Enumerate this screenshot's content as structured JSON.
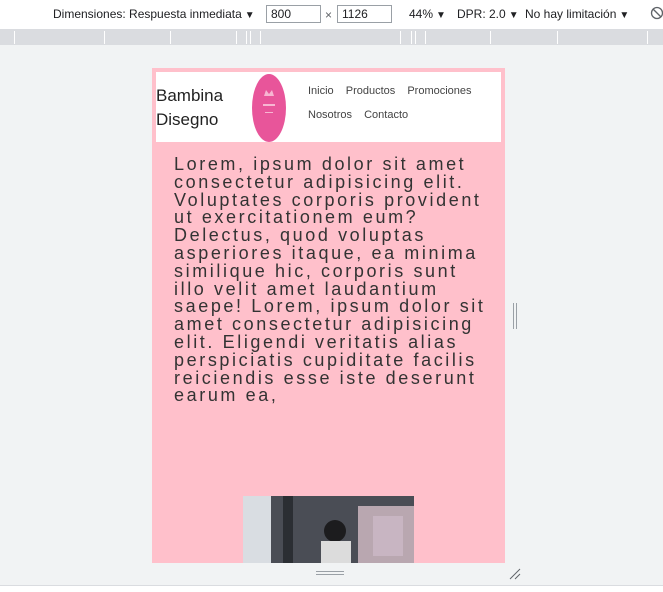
{
  "devtools": {
    "dimensions_label": "Dimensiones: Respuesta inmediata",
    "width": "800",
    "times": "×",
    "height": "1126",
    "zoom": "44%",
    "dpr": "DPR: 2.0",
    "throttle": "No hay limitación"
  },
  "site": {
    "brand": "Bambina Disegno",
    "nav": [
      "Inicio",
      "Productos",
      "Promociones",
      "Nosotros",
      "Contacto"
    ],
    "body_text": "Lorem, ipsum dolor sit amet consectetur adipisicing elit. Voluptates corporis provident ut exercitationem eum? Delectus, quod voluptas asperiores itaque, ea minima similique hic, corporis sunt illo velit amet laudantium saepe! Lorem, ipsum dolor sit amet consectetur adipisicing elit. Eligendi veritatis alias perspiciatis cupiditate facilis reiciendis esse iste deserunt earum ea,",
    "page_bg": "#ffc0cb",
    "logo_color": "#e8559a"
  }
}
